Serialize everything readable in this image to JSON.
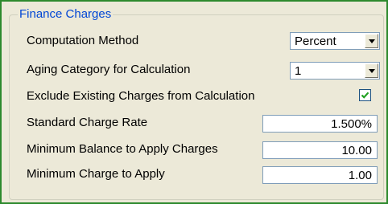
{
  "group": {
    "title": "Finance Charges"
  },
  "fields": {
    "computation_method": {
      "label": "Computation Method",
      "value": "Percent"
    },
    "aging_category": {
      "label": "Aging Category for Calculation",
      "value": "1"
    },
    "exclude_existing": {
      "label": "Exclude Existing Charges from Calculation",
      "checked": true
    },
    "standard_rate": {
      "label": "Standard Charge Rate",
      "value": "1.500%"
    },
    "minimum_balance": {
      "label": "Minimum Balance to Apply Charges",
      "value": "10.00"
    },
    "minimum_charge": {
      "label": "Minimum Charge to Apply",
      "value": "1.00"
    }
  },
  "colors": {
    "window_background": "#ece9d8",
    "group_title": "#0046d5",
    "outer_border": "#2d8a2d",
    "checkmark": "#21a121",
    "input_border": "#7f9db9"
  },
  "icons": {
    "dropdown": "chevron-down-icon",
    "check": "checkmark-icon"
  }
}
